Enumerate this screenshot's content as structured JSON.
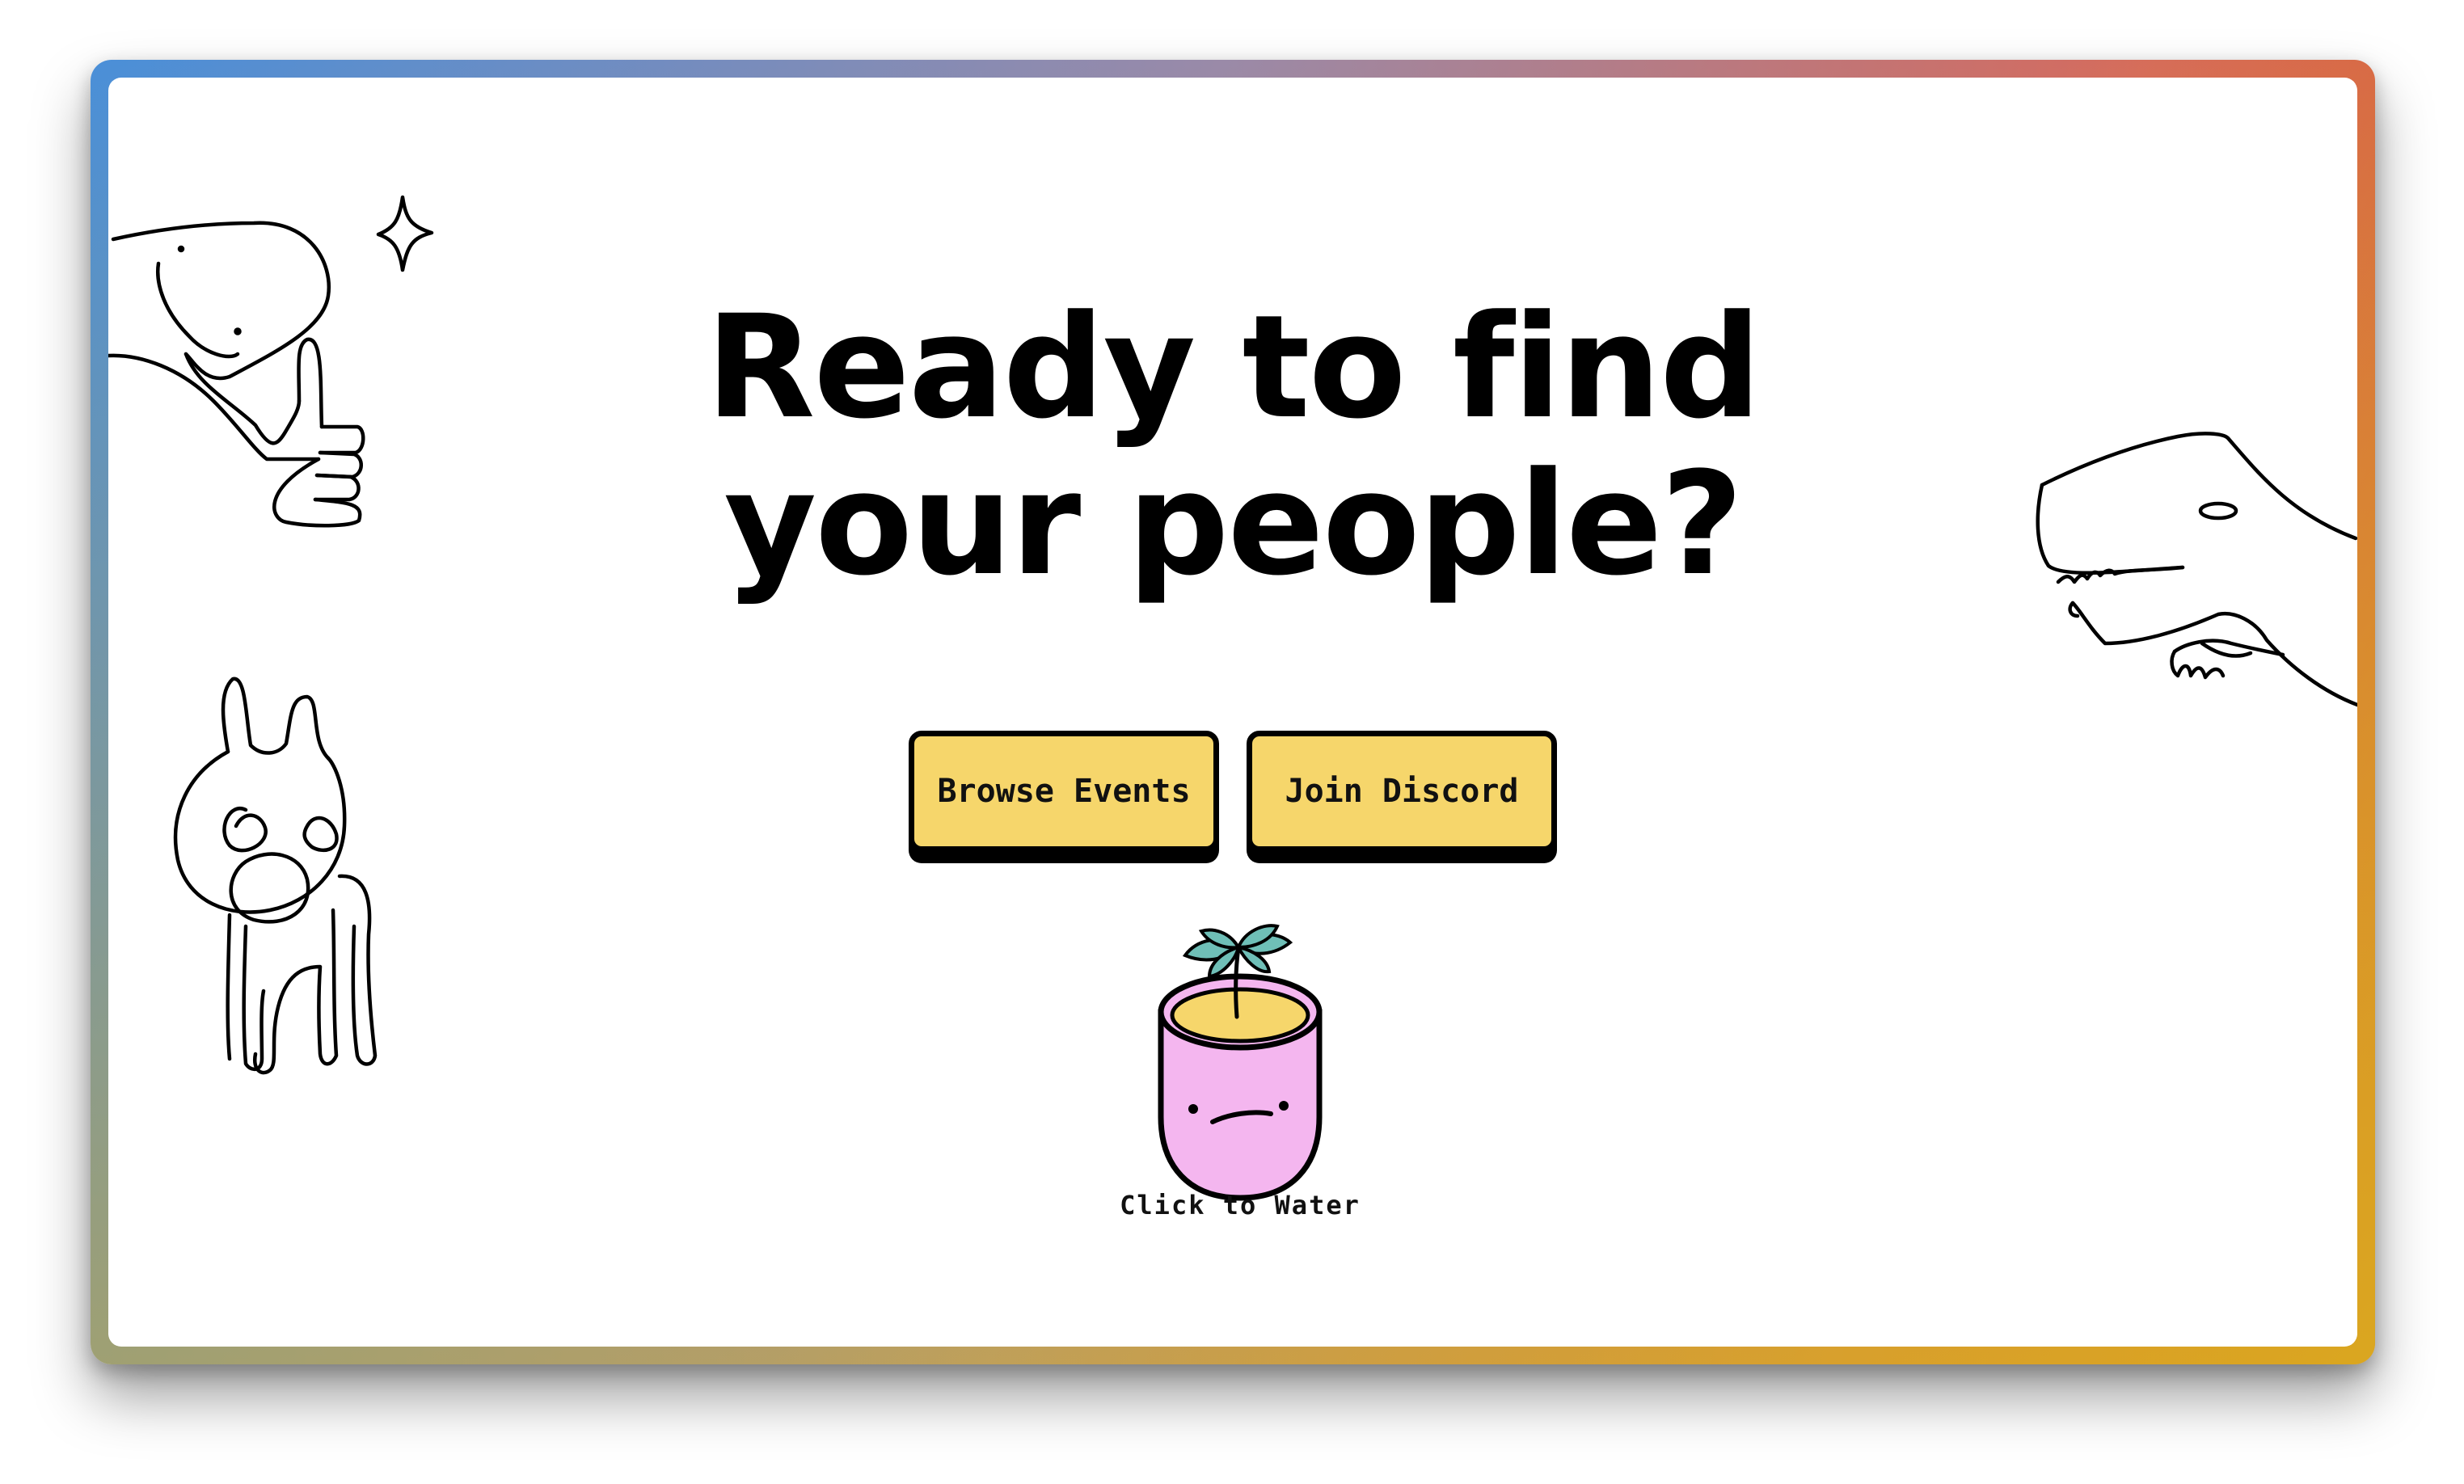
{
  "hero": {
    "title_line1": "Ready to find",
    "title_line2": "your people?"
  },
  "actions": {
    "browse_label": "Browse Events",
    "discord_label": "Join Discord"
  },
  "plant": {
    "label": "Click to Water"
  },
  "colors": {
    "button_fill": "#f6d66b",
    "pot_fill": "#f4b6ef",
    "soil_fill": "#f6d66b",
    "leaf_fill": "#6fbfb7",
    "frame_gradient_start": "#4a8fd8",
    "frame_gradient_end": "#d9503f",
    "frame_gradient_bottom": "#d8ab1e"
  },
  "icons": {
    "doodle_top_left": "dinosaur-thumbs-up-icon",
    "sparkle": "sparkle-icon",
    "doodle_bottom_left": "creature-icon",
    "doodle_right": "t-rex-icon",
    "plant": "plant-pot-icon"
  }
}
